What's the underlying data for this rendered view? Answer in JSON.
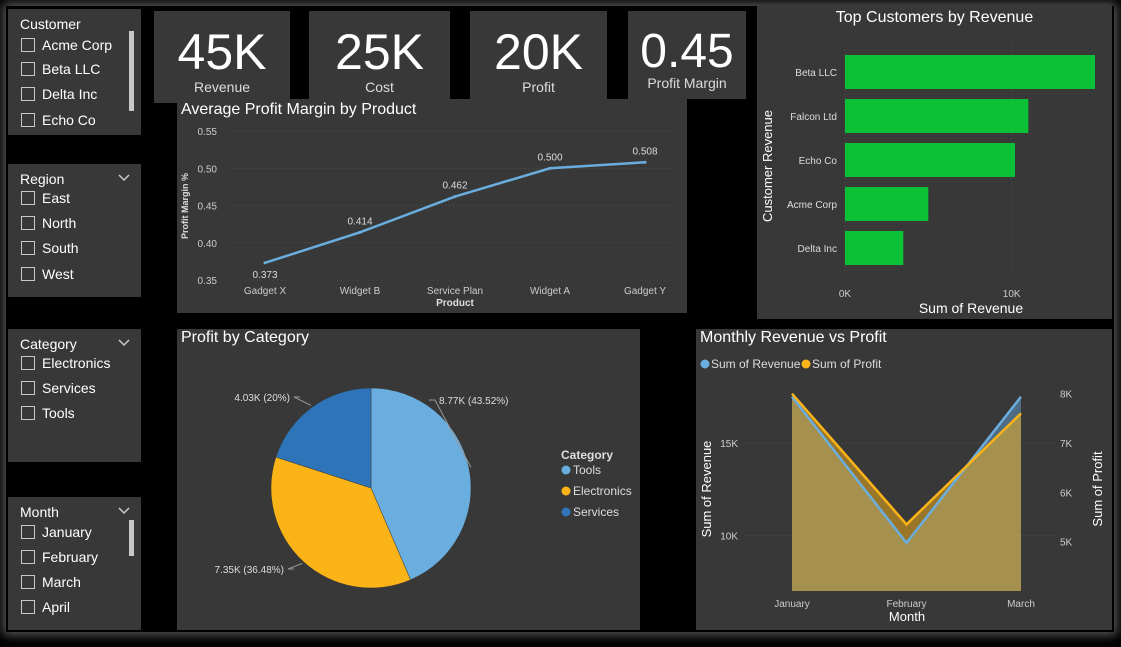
{
  "slicers": {
    "customer": {
      "title": "Customer",
      "items": [
        "Acme Corp",
        "Beta LLC",
        "Delta Inc",
        "Echo Co"
      ]
    },
    "region": {
      "title": "Region",
      "items": [
        "East",
        "North",
        "South",
        "West"
      ]
    },
    "category": {
      "title": "Category",
      "items": [
        "Electronics",
        "Services",
        "Tools"
      ]
    },
    "month": {
      "title": "Month",
      "items": [
        "January",
        "February",
        "March",
        "April"
      ]
    }
  },
  "kpis": [
    {
      "value": "45K",
      "label": "Revenue"
    },
    {
      "value": "25K",
      "label": "Cost"
    },
    {
      "value": "20K",
      "label": "Profit"
    },
    {
      "value": "0.45",
      "label": "Profit Margin"
    }
  ],
  "colors": {
    "green": "#0cc136",
    "blue": "#6aaee0",
    "darkblue": "#2e74b8",
    "yellow": "#fbb418",
    "panel": "#383838"
  },
  "chart_data": [
    {
      "type": "line",
      "title": "Average Profit Margin by Product",
      "xlabel": "Product",
      "ylabel": "Profit Margin %",
      "categories": [
        "Gadget X",
        "Widget B",
        "Service Plan",
        "Widget A",
        "Gadget Y"
      ],
      "values": [
        0.373,
        0.414,
        0.462,
        0.5,
        0.508
      ],
      "data_labels": [
        "0.373",
        "0.414",
        "0.462",
        "0.500",
        "0.508"
      ],
      "yticks": [
        "0.55",
        "0.50",
        "0.45",
        "0.40",
        "0.35"
      ],
      "ylim": [
        0.35,
        0.55
      ]
    },
    {
      "type": "bar",
      "title": "Top Customers by Revenue",
      "xlabel": "Sum of Revenue",
      "ylabel": "Customer Revenue",
      "categories": [
        "Beta LLC",
        "Falcon Ltd",
        "Echo Co",
        "Acme Corp",
        "Delta Inc"
      ],
      "values": [
        15000,
        11000,
        10200,
        5000,
        3500
      ],
      "xticks": [
        "0K",
        "10K"
      ],
      "xlim": [
        0,
        15000
      ]
    },
    {
      "type": "pie",
      "title": "Profit by Category",
      "legend_title": "Category",
      "categories": [
        "Tools",
        "Electronics",
        "Services"
      ],
      "values": [
        8770,
        7350,
        4030
      ],
      "labels": [
        "8.77K (43.52%)",
        "7.35K (36.48%)",
        "4.03K (20%)"
      ],
      "legend_position": "right"
    },
    {
      "type": "area",
      "title": "Monthly Revenue vs Profit",
      "xlabel": "Month",
      "ylabel": "Sum of Revenue",
      "y2label": "Sum of Profit",
      "categories": [
        "January",
        "February",
        "March"
      ],
      "series": [
        {
          "name": "Sum of Revenue",
          "values": [
            17500,
            9600,
            17500
          ]
        },
        {
          "name": "Sum of Profit",
          "values": [
            8000,
            5350,
            7600
          ]
        }
      ],
      "yticks": [
        "15K",
        "10K"
      ],
      "y2ticks": [
        "8K",
        "7K",
        "6K",
        "5K"
      ],
      "ylim": [
        7000,
        19000
      ],
      "y2lim": [
        4000,
        8500
      ],
      "legend_position": "top-left"
    }
  ]
}
